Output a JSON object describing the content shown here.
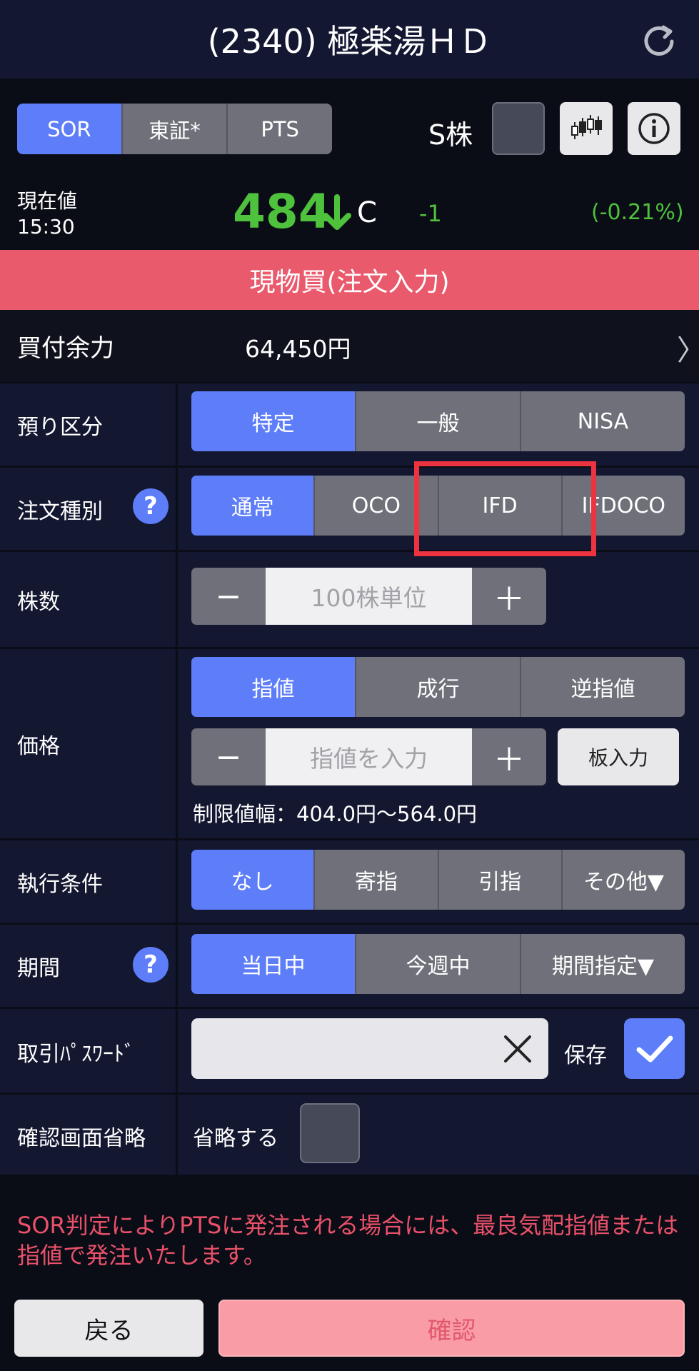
{
  "header": {
    "title": "(2340) 極楽湯ＨＤ",
    "refresh_icon": "refresh-icon"
  },
  "market": {
    "tabs": [
      "SOR",
      "東証*",
      "PTS"
    ],
    "active_tab": "SOR",
    "s_label": "S株"
  },
  "quote": {
    "label_line1": "現在値",
    "label_line2": "15:30",
    "price": "484",
    "c_mark": "C",
    "change": "-1",
    "change_pct": "(-0.21%)",
    "price_color": "#4ec23c"
  },
  "order_banner": "現物買(注文入力)",
  "buying_power": {
    "label": "買付余力",
    "value": "64,450円",
    "chevron": "〉"
  },
  "deposit": {
    "label": "預り区分",
    "options": [
      "特定",
      "一般",
      "NISA"
    ],
    "active": "特定"
  },
  "order_type": {
    "label": "注文種別",
    "help": "?",
    "options": [
      "通常",
      "OCO",
      "IFD",
      "IFDOCO"
    ],
    "active": "通常"
  },
  "shares": {
    "label": "株数",
    "minus": "−",
    "placeholder": "100株単位",
    "plus": "＋"
  },
  "price": {
    "label": "価格",
    "options": [
      "指値",
      "成行",
      "逆指値"
    ],
    "active": "指値",
    "minus": "−",
    "placeholder": "指値を入力",
    "plus": "＋",
    "board_button": "板入力",
    "limit_range": "制限値幅：404.0円〜564.0円"
  },
  "execution": {
    "label": "執行条件",
    "options": [
      "なし",
      "寄指",
      "引指",
      "その他▼"
    ],
    "active": "なし"
  },
  "period": {
    "label": "期間",
    "help": "?",
    "options": [
      "当日中",
      "今週中",
      "期間指定▼"
    ],
    "active": "当日中"
  },
  "password": {
    "label": "取引ﾊﾟｽﾜｰﾄﾞ",
    "save_label": "保存",
    "save_checked": true
  },
  "skip_confirm": {
    "label": "確認画面省略",
    "option_label": "省略する",
    "checked": false
  },
  "notice": "SOR判定によりPTSに発注される場合には、最良気配指値または指値で発注いたします。",
  "footer": {
    "back": "戻る",
    "confirm": "確認"
  },
  "colors": {
    "accent": "#5d7df9",
    "buy": "#e95a6d",
    "highlight": "#ee3340"
  }
}
